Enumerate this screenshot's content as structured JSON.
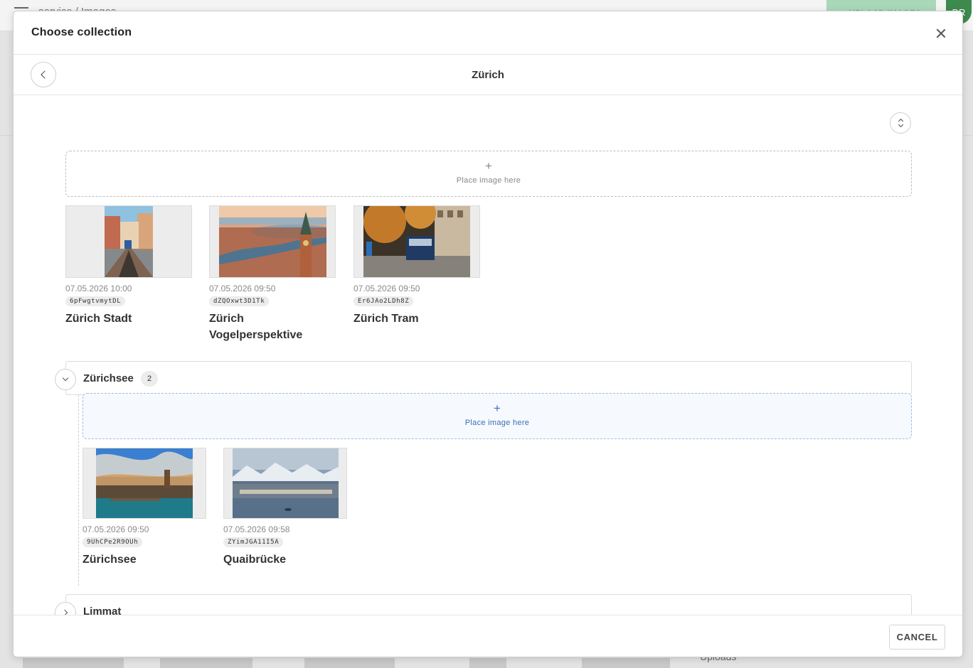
{
  "background": {
    "breadcrumb": "service / Images",
    "upload_button": "+ UPLOAD IMAGES",
    "avatar_initials": "DR",
    "uploads_label": "Uploads"
  },
  "modal": {
    "title": "Choose collection",
    "collection_title": "Zürich",
    "dropzone_label": "Place image here",
    "dropzone_plus": "+",
    "cancel_label": "CANCEL"
  },
  "root_images": [
    {
      "date": "07.05.2026 10:00",
      "id": "6pFwgtvmytDL",
      "name": "Zürich Stadt"
    },
    {
      "date": "07.05.2026 09:50",
      "id": "dZQOxwt3D1Tk",
      "name": "Zürich Vogelperspektive"
    },
    {
      "date": "07.05.2026 09:50",
      "id": "Er6JAo2LDh8Z",
      "name": "Zürich Tram"
    }
  ],
  "groups": [
    {
      "name": "Zürichsee",
      "count": "2",
      "expanded": true,
      "images": [
        {
          "date": "07.05.2026 09:50",
          "id": "9UhCPe2R9OUh",
          "name": "Zürichsee"
        },
        {
          "date": "07.05.2026 09:58",
          "id": "ZYimJGA11I5A",
          "name": "Quaibrücke"
        }
      ]
    },
    {
      "name": "Limmat",
      "expanded": false
    }
  ],
  "colors": {
    "dropzone_active_border": "#9fbde6",
    "dropzone_active_text": "#3b6fb6",
    "upload_button_bg": "#a9d8b8",
    "avatar_bg": "#3d8a4e"
  },
  "icons": [
    "close-icon",
    "chevron-left-icon",
    "sort-icon",
    "plus-icon",
    "chevron-down-icon",
    "chevron-right-icon"
  ]
}
